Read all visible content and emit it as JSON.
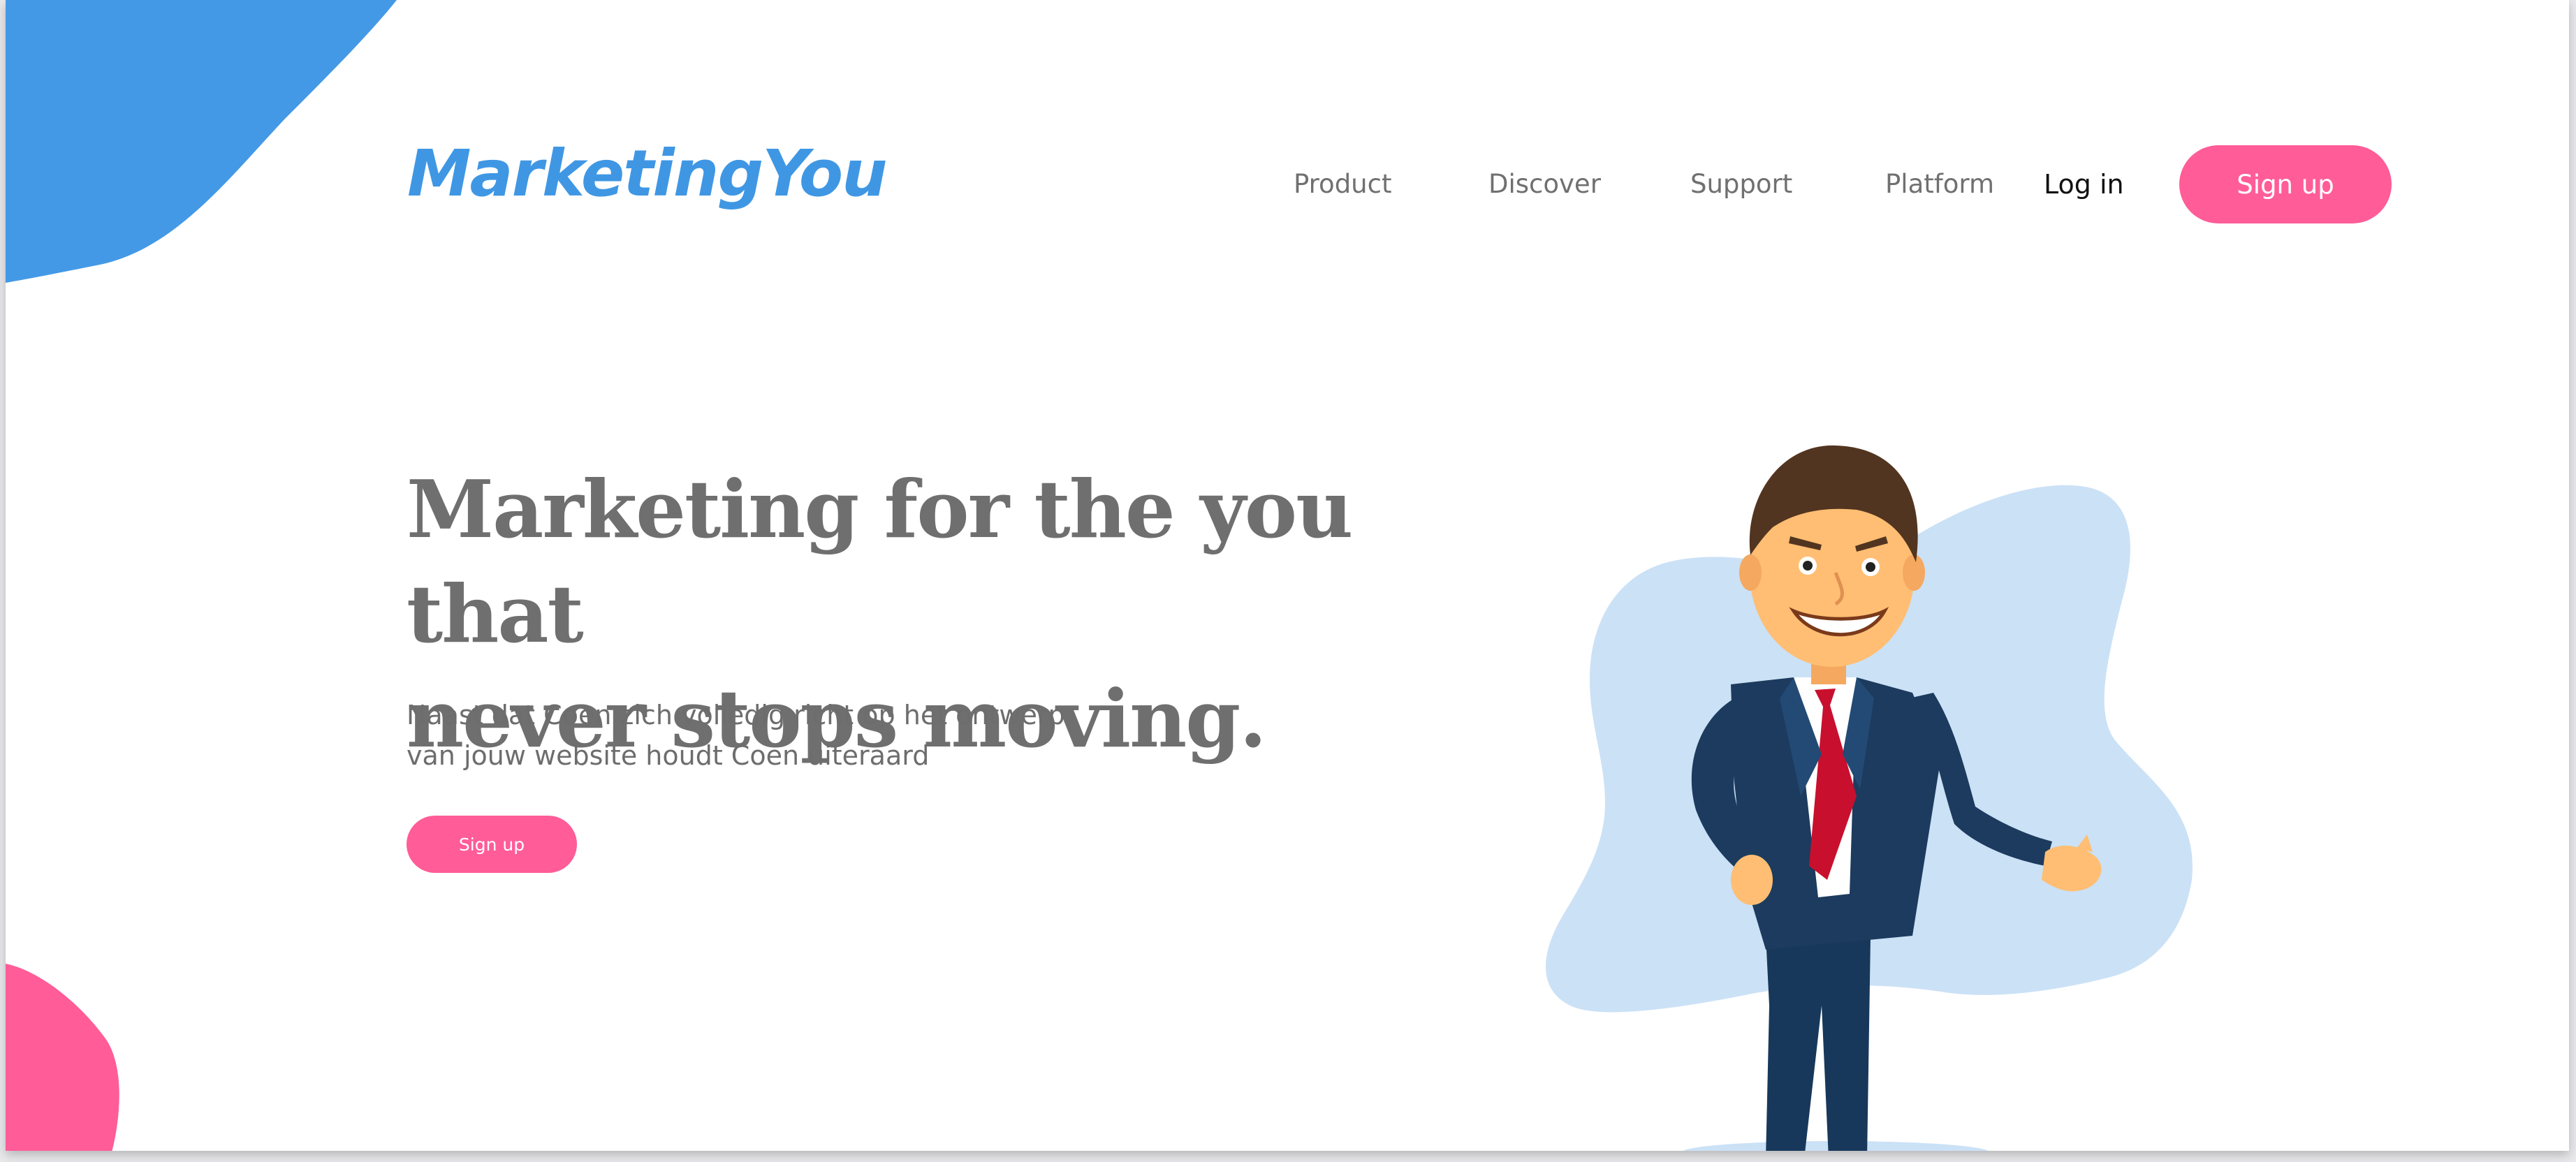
{
  "header": {
    "logo_text": "MarketingYou",
    "nav": {
      "product": "Product",
      "discover": "Discover",
      "support": "Support",
      "platform": "Platform"
    },
    "login_label": "Log in",
    "signup_label": "Sign up"
  },
  "hero": {
    "title_line1": "Marketing for the you that",
    "title_line2": "never stops moving.",
    "subtitle_line1": "Naast dat Coen zich volledig richt op het ontwerp",
    "subtitle_line2": "van jouw website houdt Coen uiteraard",
    "cta_label": "Sign up"
  },
  "colors": {
    "brand_blue": "#3f97e4",
    "accent_pink": "#ff5c98",
    "blob_light_blue": "#cbe1f6",
    "text_gray": "#6f6f6f"
  },
  "icons": {
    "illustration": "businessman-illustration",
    "decor_top_left": "blue-blob-shape",
    "decor_bottom_left": "pink-blob-shape"
  }
}
